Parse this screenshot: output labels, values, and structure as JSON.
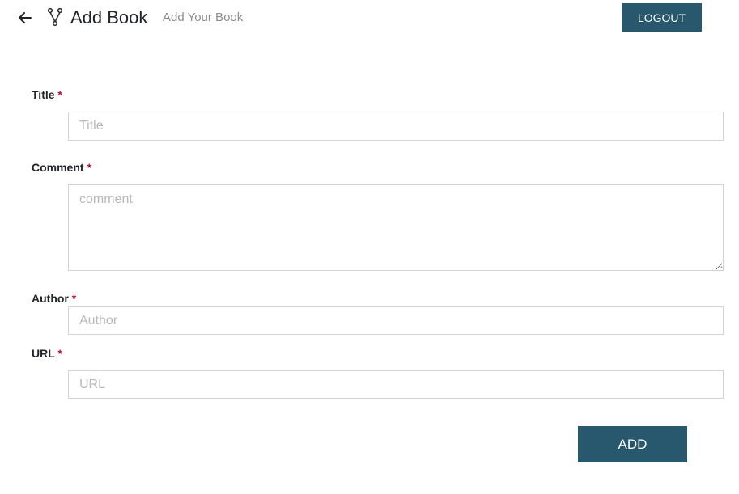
{
  "header": {
    "back_icon": "arrow-left-icon",
    "brand_icon": "fork-branch-icon",
    "title": "Add Book",
    "subtitle": "Add Your Book",
    "logout_label": "LOGOUT"
  },
  "form": {
    "required_marker": "*",
    "title": {
      "label": "Title",
      "placeholder": "Title",
      "value": ""
    },
    "comment": {
      "label": "Comment",
      "placeholder": "comment",
      "value": ""
    },
    "author": {
      "label": "Author",
      "placeholder": "Author",
      "value": ""
    },
    "url": {
      "label": "URL",
      "placeholder": "URL",
      "value": ""
    },
    "submit_label": "ADD"
  },
  "colors": {
    "primary": "#27586e",
    "required": "#b0122f",
    "placeholder": "#b8b8b8",
    "border": "#d4d4d4"
  }
}
